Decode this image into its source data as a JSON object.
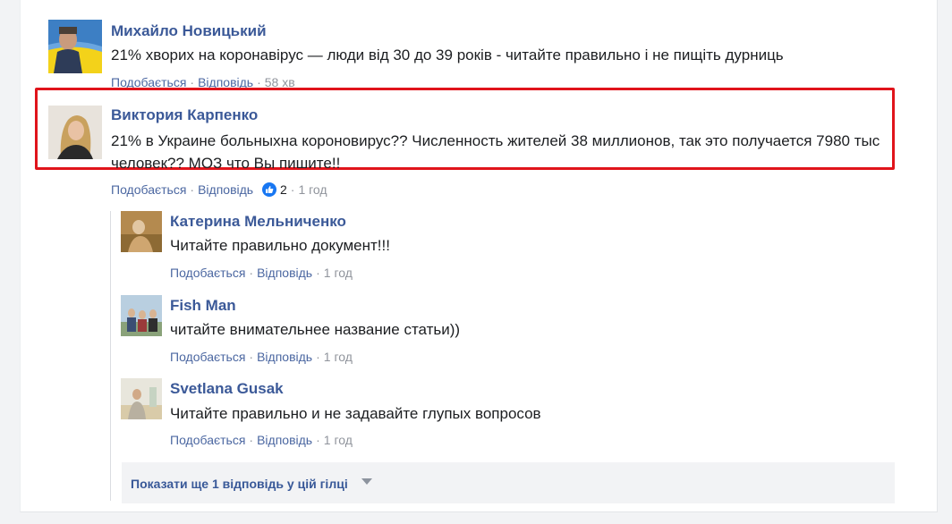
{
  "comments": [
    {
      "author": "Михайло Новицький",
      "text": "21% хворих на коронавірус — люди від 30 до 39 років - читайте правильно і не пищіть дурниць",
      "like_label": "Подобається",
      "reply_label": "Відповідь",
      "time": "58 хв"
    },
    {
      "author": "Виктория Карпенко",
      "text": "21% в Украине больныхна короновирус?? Численность жителей 38 миллионов, так это получается 7980 тыс человек?? МОЗ что Вы пишите!!",
      "like_label": "Подобається",
      "reply_label": "Відповідь",
      "reactions": "2",
      "time": "1 год",
      "highlight_color": "#e0141b"
    }
  ],
  "replies": [
    {
      "author": "Катерина Мельниченко",
      "text": "Читайте правильно документ!!!",
      "like_label": "Подобається",
      "reply_label": "Відповідь",
      "time": "1 год"
    },
    {
      "author": "Fish Man",
      "text": "читайте внимательнее название статьи))",
      "like_label": "Подобається",
      "reply_label": "Відповідь",
      "time": "1 год"
    },
    {
      "author": "Svetlana Gusak",
      "text": "Читайте правильно и не задавайте глупых вопросов",
      "like_label": "Подобається",
      "reply_label": "Відповідь",
      "time": "1 год"
    }
  ],
  "more_replies": {
    "label": "Показати ще 1 відповідь у цій гілці",
    "icon": "caret-down-icon"
  },
  "colors": {
    "link": "#4b67a1",
    "name": "#3b5998",
    "meta": "#90949c",
    "highlight": "#e0141b",
    "like_badge": "#1877f2"
  }
}
